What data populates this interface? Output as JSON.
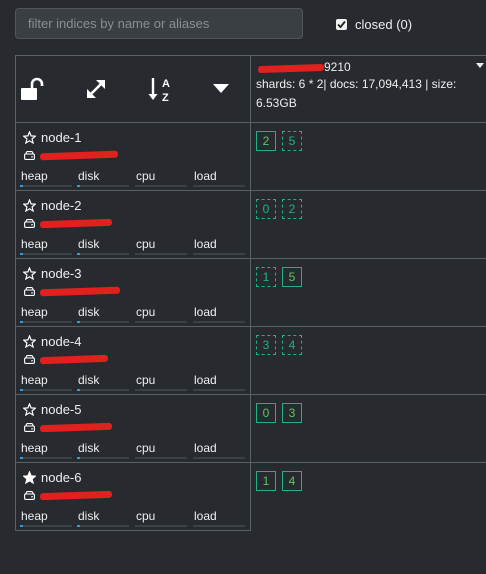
{
  "search": {
    "placeholder": "filter indices by name or aliases"
  },
  "closed_filter": {
    "label": "closed (0)",
    "checked": true
  },
  "index": {
    "name_visible_suffix": "9210",
    "stats_line1": "shards: 6 * 2| docs: 17,094,413 | size:",
    "stats_line2": "6.53GB"
  },
  "header_icons": [
    "unlock-icon",
    "expand-icon",
    "sort-az-icon",
    "caret-down-icon"
  ],
  "metric_labels": {
    "heap": "heap",
    "disk": "disk",
    "cpu": "cpu",
    "load": "load"
  },
  "nodes": [
    {
      "name": "node-1",
      "master": false,
      "shards": [
        {
          "id": "2",
          "type": "primary"
        },
        {
          "id": "5",
          "type": "replica"
        }
      ]
    },
    {
      "name": "node-2",
      "master": false,
      "shards": [
        {
          "id": "0",
          "type": "replica"
        },
        {
          "id": "2",
          "type": "replica"
        }
      ]
    },
    {
      "name": "node-3",
      "master": false,
      "shards": [
        {
          "id": "1",
          "type": "replica"
        },
        {
          "id": "5",
          "type": "primary"
        }
      ]
    },
    {
      "name": "node-4",
      "master": false,
      "shards": [
        {
          "id": "3",
          "type": "replica"
        },
        {
          "id": "4",
          "type": "replica"
        }
      ]
    },
    {
      "name": "node-5",
      "master": false,
      "shards": [
        {
          "id": "0",
          "type": "primary"
        },
        {
          "id": "3",
          "type": "primary"
        }
      ]
    },
    {
      "name": "node-6",
      "master": true,
      "shards": [
        {
          "id": "1",
          "type": "primary"
        },
        {
          "id": "4",
          "type": "primary"
        }
      ]
    }
  ],
  "colors": {
    "background": "#272b30",
    "accent": "#1fb085",
    "redaction": "#e0211e"
  }
}
